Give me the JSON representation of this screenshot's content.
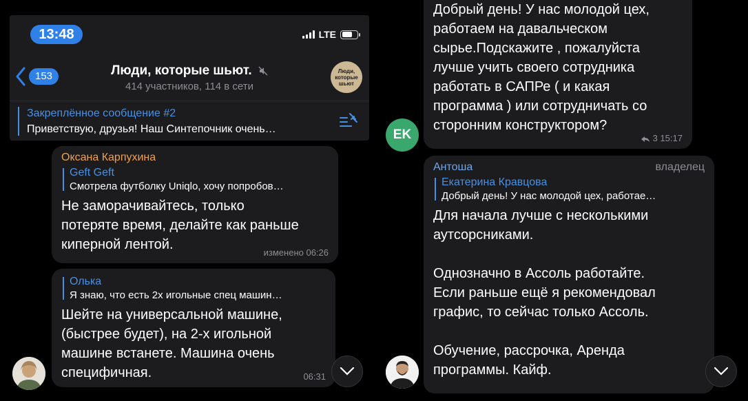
{
  "status": {
    "time": "13:48",
    "network": "LTE"
  },
  "header": {
    "back_count": "153",
    "title": "Люди, которые шьют.",
    "subtitle": "414 участников, 114 в сети",
    "avatar_text": "Люди, которые шьют"
  },
  "pinned": {
    "title": "Закреплённое сообщение #2",
    "text": "Приветствую, друзья!  Наш Синтепочник очень…"
  },
  "left_messages": [
    {
      "sender": "Оксана Карпухина",
      "sender_color": "#f0a050",
      "reply_name": "Geft Geft",
      "reply_text": "Смотрела футболку Uniqlo, хочу попробов…",
      "text": "Не заморачивайтесь, только\nпотеряте время,  делайте как раньше\nкиперной лентой.",
      "meta": "изменено 06:26"
    },
    {
      "reply_name": "Олька",
      "reply_text": "Я знаю, что есть 2х игольные спец машин…",
      "text": "Шейте на универсальной машине,\n(быстрее будет), на 2-х игольной\nмашине встанете. Машина очень\nспецифичная.",
      "meta": "06:31"
    }
  ],
  "right_messages": [
    {
      "avatar_initials": "EK",
      "avatar_color": "#3aa76d",
      "text": "Добрый день! У нас молодой цех,\nработаем на давальческом\nсырье.Подскажите ,  пожалуйста\nлучше учить своего сотрудника\nработать в САПРе  ( и какая\nпрограмма ) или сотрудничать со\nсторонним конструктором?",
      "replies": "3",
      "time": "15:17"
    },
    {
      "sender": "Антоша",
      "sender_color": "#6ea8e8",
      "role": "владелец",
      "reply_name": "Екатерина Кравцова",
      "reply_text": "Добрый день! У нас молодой цех, работае…",
      "text": "Для начала лучше с несколькими\nаутсорсниками.\n\nОднозначно в Ассоль работайте.\nЕсли раньше ещё я рекомендовал\nграфис, то сейчас только Ассоль.\n\nОбучение, рассрочка, Аренда\nпрограммы. Кайф."
    }
  ],
  "colors": {
    "accent": "#2f81e8",
    "bubble": "#1c1c1e",
    "link": "#4a90e2",
    "muted": "#8e8e93"
  }
}
